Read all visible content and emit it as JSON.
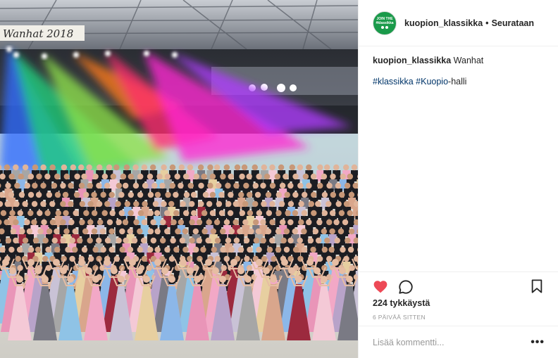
{
  "photo": {
    "banner_text": "Wanhat 2018",
    "beam_colors": [
      "#2f6bff",
      "#1fd07a",
      "#8ee24a",
      "#ff7a1a",
      "#ff2d6e",
      "#ff29d2",
      "#b03bff"
    ]
  },
  "post": {
    "avatar_text": "JOIN THE #klassikka",
    "username": "kuopion_klassikka",
    "separator": "•",
    "follow_label": "Seurataan",
    "caption_user": "kuopion_klassikka",
    "caption_text": "Wanhat",
    "hashtags": [
      "#klassikka",
      "#Kuopio"
    ],
    "tag_suffix": "-halli",
    "likes": "224 tykkäystä",
    "time": "6 päivää sitten",
    "comment_placeholder": "Lisää kommentti...",
    "more_label": "•••"
  },
  "icons": {
    "like": "heart-icon",
    "comment": "comment-bubble-icon",
    "save": "bookmark-icon"
  },
  "colors": {
    "like_red": "#ed4956",
    "hashtag_blue": "#003569",
    "muted_gray": "#999999",
    "avatar_green": "#1a9a4a"
  }
}
